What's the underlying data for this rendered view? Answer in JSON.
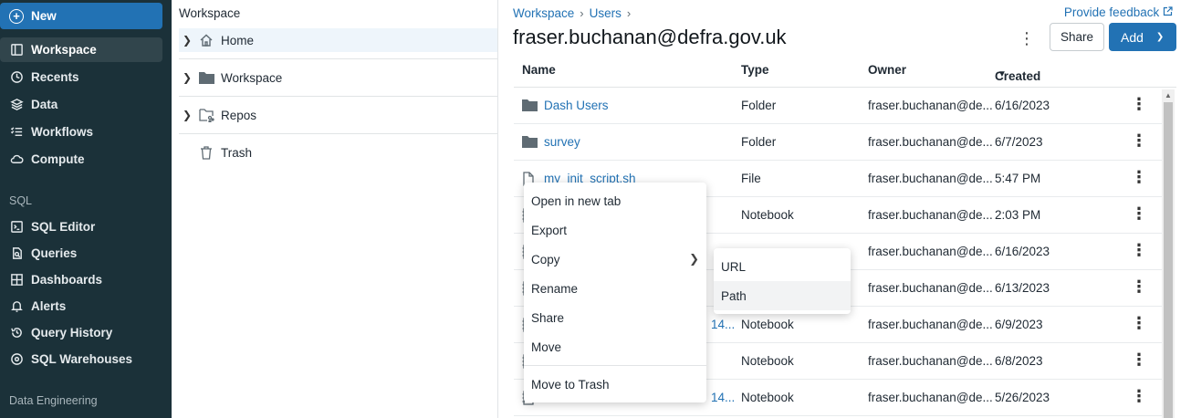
{
  "nav": {
    "new_label": "New",
    "items": [
      {
        "label": "Workspace",
        "icon": "workspace-icon",
        "active": true
      },
      {
        "label": "Recents",
        "icon": "clock-icon"
      },
      {
        "label": "Data",
        "icon": "data-icon"
      },
      {
        "label": "Workflows",
        "icon": "workflows-icon"
      },
      {
        "label": "Compute",
        "icon": "cloud-icon"
      }
    ],
    "sql_section": "SQL",
    "sql_items": [
      {
        "label": "SQL Editor",
        "icon": "sql-editor-icon"
      },
      {
        "label": "Queries",
        "icon": "queries-icon"
      },
      {
        "label": "Dashboards",
        "icon": "dashboards-icon"
      },
      {
        "label": "Alerts",
        "icon": "bell-icon"
      },
      {
        "label": "Query History",
        "icon": "history-icon"
      },
      {
        "label": "SQL Warehouses",
        "icon": "warehouse-icon"
      }
    ],
    "de_section": "Data Engineering"
  },
  "tree": {
    "title": "Workspace",
    "items": [
      {
        "label": "Home",
        "icon": "home-icon"
      },
      {
        "label": "Workspace",
        "icon": "folder-icon"
      },
      {
        "label": "Repos",
        "icon": "repos-icon"
      },
      {
        "label": "Trash",
        "icon": "trash-icon"
      }
    ]
  },
  "main": {
    "breadcrumb": [
      "Workspace",
      "Users"
    ],
    "feedback": "Provide feedback",
    "title": "fraser.buchanan@defra.gov.uk",
    "share_label": "Share",
    "add_label": "Add",
    "columns": {
      "name": "Name",
      "type": "Type",
      "owner": "Owner",
      "created": "Created"
    },
    "rows": [
      {
        "name": "Dash Users",
        "icon": "folder-icon",
        "type": "Folder",
        "owner": "fraser.buchanan@de...",
        "created": "6/16/2023"
      },
      {
        "name": "survey",
        "icon": "folder-icon",
        "type": "Folder",
        "owner": "fraser.buchanan@de...",
        "created": "6/7/2023"
      },
      {
        "name": "my_init_script.sh",
        "icon": "file-icon",
        "type": "File",
        "owner": "fraser.buchanan@de...",
        "created": "5:47 PM"
      },
      {
        "name": "",
        "icon": "notebook-icon",
        "type": "Notebook",
        "owner": "fraser.buchanan@de...",
        "created": "2:03 PM"
      },
      {
        "name": "",
        "icon": "notebook-icon",
        "type": "",
        "owner": "fraser.buchanan@de...",
        "created": "6/16/2023"
      },
      {
        "name": "",
        "icon": "notebook-icon",
        "type": "",
        "owner": "fraser.buchanan@de...",
        "created": "6/13/2023"
      },
      {
        "name": "14...",
        "icon": "notebook-icon",
        "type": "Notebook",
        "owner": "fraser.buchanan@de...",
        "created": "6/9/2023"
      },
      {
        "name": "",
        "icon": "notebook-icon",
        "type": "Notebook",
        "owner": "fraser.buchanan@de...",
        "created": "6/8/2023"
      },
      {
        "name": "14...",
        "icon": "notebook-icon",
        "type": "Notebook",
        "owner": "fraser.buchanan@de...",
        "created": "5/26/2023"
      }
    ]
  },
  "context_menu": {
    "items": [
      "Open in new tab",
      "Export",
      "Copy",
      "Rename",
      "Share",
      "Move",
      "Move to Trash"
    ],
    "submenu": [
      "URL",
      "Path"
    ]
  }
}
